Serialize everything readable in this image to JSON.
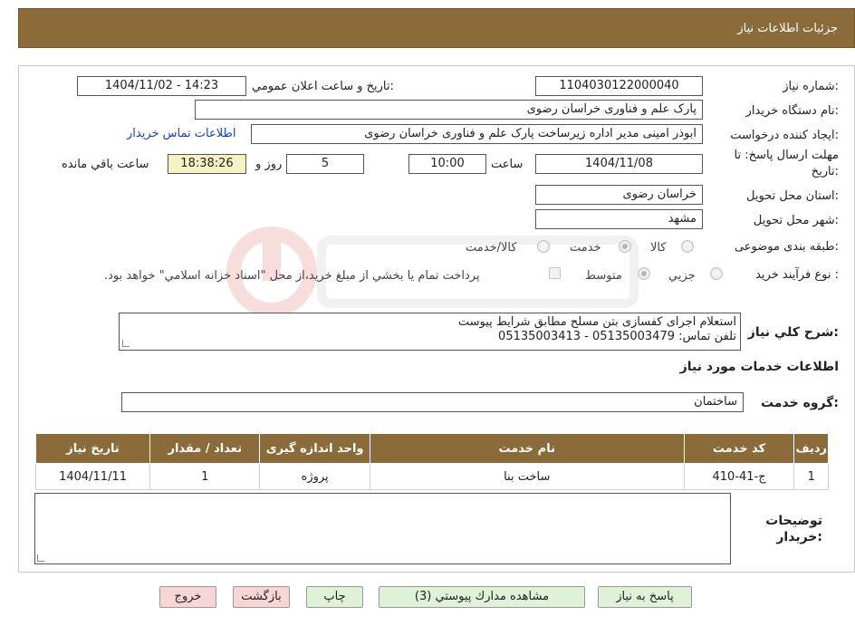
{
  "header": {
    "title": "جزئیات اطلاعات نیاز"
  },
  "form": {
    "need_number_label": "شماره نیاز:",
    "need_number": "1104030122000040",
    "announce_label": "تاریخ و ساعت اعلان عمومي:",
    "announce_value": "1404/11/02 - 14:23",
    "buyer_org_label": "نام دستگاه خريدار:",
    "buyer_org": "پارک علم و فناوری خراسان رضوی",
    "requester_label": "ايجاد كننده درخواست:",
    "requester": "ابوذر امینی مدیر اداره زیرساخت پارک علم و فناوری خراسان رضوی",
    "contact_link": "اطلاعات تماس خريدار",
    "deadline_label_1": "مهلت ارسال پاسخ: تا",
    "deadline_label_2": "تاريخ:",
    "deadline_date": "1404/11/08",
    "time_label": "ساعت",
    "deadline_time": "10:00",
    "days_value": "5",
    "days_label": "روز و",
    "remaining_time": "18:38:26",
    "remaining_label": "ساعت باقي مانده",
    "province_label": "استان محل تحويل:",
    "province": "خراسان رضوی",
    "city_label": "شهر محل تحويل:",
    "city": "مشهد",
    "category_label": "طبقه بندی موضوعی:",
    "category_options": [
      "کالا",
      "خدمت",
      "کالا/خدمت"
    ],
    "category_selected": "خدمت",
    "process_label": "نوع فرآيند خريد :",
    "process_options": [
      "جزيي",
      "متوسط"
    ],
    "process_selected": "متوسط",
    "payment_note": "پرداخت تمام يا بخشي از مبلغ خريد،از محل \"اسناد خزانه اسلامي\" خواهد بود."
  },
  "description": {
    "label": "شرح كلي نياز:",
    "line1": "استعلام اجرای کفسازی بتن مسلح مطابق شرایط پیوست",
    "line2": "تلفن تماس: 05135003479 - 05135003413"
  },
  "services": {
    "section_title": "اطلاعات خدمات مورد نياز",
    "group_label": "گروه خدمت:",
    "group_value": "ساختمان",
    "table": {
      "headers": [
        "رديف",
        "كد خدمت",
        "نام خدمت",
        "واحد اندازه گيری",
        "تعداد / مقدار",
        "تاريخ نياز"
      ],
      "rows": [
        [
          "1",
          "ج-41-410",
          "ساخت بنا",
          "پروژه",
          "1",
          "1404/11/11"
        ]
      ]
    }
  },
  "buyer_notes": {
    "label_1": "توضيحات",
    "label_2": "خريدار:",
    "value": ""
  },
  "buttons": {
    "reply": "پاسخ به نياز",
    "attachments": "مشاهده مدارك پيوستي (3)",
    "print": "چاپ",
    "back": "بازگشت",
    "exit": "خروج"
  },
  "colors": {
    "header_bg": "#8b6b3a",
    "link": "#1a3fbf",
    "btn_green": "#dff2d8",
    "btn_pink": "#f9d6d6",
    "remaining_bg": "#f6f2c6"
  }
}
